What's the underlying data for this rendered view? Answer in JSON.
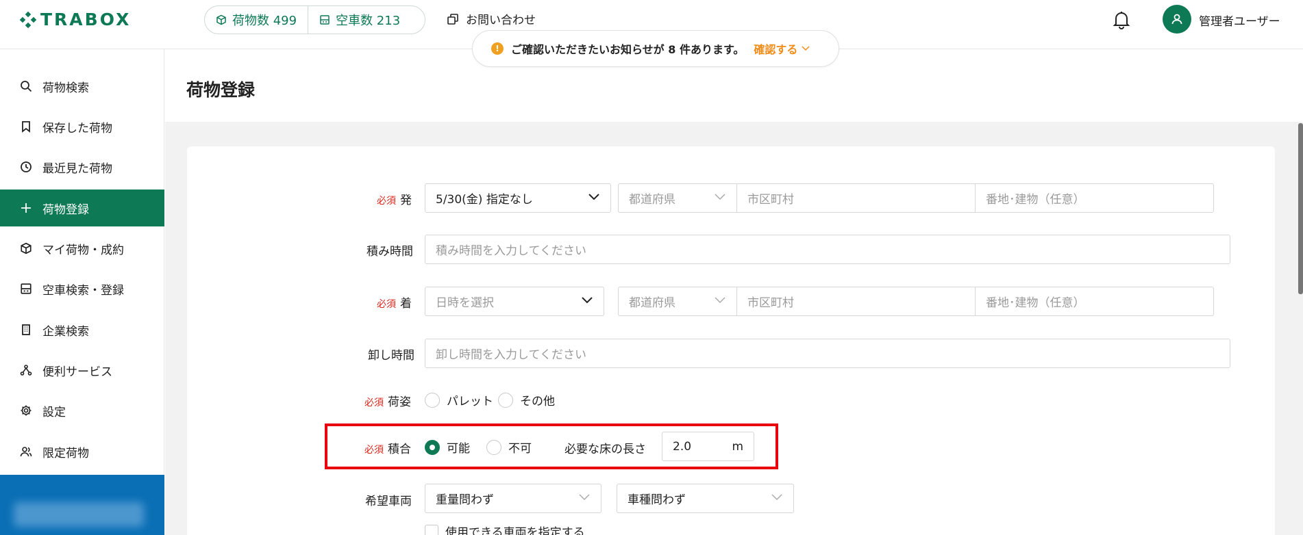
{
  "header": {
    "logo_text": "TRABOX",
    "cargo_count_label": "荷物数 499",
    "truck_count_label": "空車数 213",
    "contact_label": "お問い合わせ",
    "user_name": "管理者ユーザー"
  },
  "notice": {
    "info_mark": "!",
    "message": "ご確認いただきたいお知らせが 8 件あります。",
    "confirm_label": "確認する"
  },
  "sidebar": {
    "items": [
      {
        "label": "荷物検索",
        "icon": "search-icon"
      },
      {
        "label": "保存した荷物",
        "icon": "bookmark-icon"
      },
      {
        "label": "最近見た荷物",
        "icon": "history-icon"
      },
      {
        "label": "荷物登録",
        "icon": "plus-icon",
        "active": true
      },
      {
        "label": "マイ荷物・成約",
        "icon": "cube-icon"
      },
      {
        "label": "空車検索・登録",
        "icon": "truck-icon"
      },
      {
        "label": "企業検索",
        "icon": "building-icon"
      },
      {
        "label": "便利サービス",
        "icon": "network-icon"
      },
      {
        "label": "設定",
        "icon": "gear-icon"
      },
      {
        "label": "限定荷物",
        "icon": "people-icon"
      }
    ]
  },
  "page": {
    "title": "荷物登録"
  },
  "form": {
    "required_tag": "必須",
    "departure": {
      "label": "発",
      "date_value": "5/30(金) 指定なし",
      "prefecture_placeholder": "都道府県",
      "city_placeholder": "市区町村",
      "address_placeholder": "番地･建物（任意）"
    },
    "loading_time": {
      "label": "積み時間",
      "placeholder": "積み時間を入力してください"
    },
    "arrival": {
      "label": "着",
      "date_placeholder": "日時を選択",
      "prefecture_placeholder": "都道府県",
      "city_placeholder": "市区町村",
      "address_placeholder": "番地･建物（任意）"
    },
    "unloading_time": {
      "label": "卸し時間",
      "placeholder": "卸し時間を入力してください"
    },
    "packing": {
      "label": "荷姿",
      "option1": "パレット",
      "option2": "その他"
    },
    "consolidation": {
      "label": "積合",
      "option_yes": "可能",
      "option_no": "不可",
      "selected": "可能",
      "floor_length_label": "必要な床の長さ",
      "floor_length_value": "2.0",
      "floor_length_unit": "m"
    },
    "vehicle": {
      "label": "希望車両",
      "weight_value": "重量問わず",
      "type_value": "車種問わず",
      "specify_label": "使用できる車両を指定する"
    }
  },
  "colors": {
    "brand": "#0d7a55",
    "required": "#d9261c",
    "highlight": "#e8000f",
    "notice_accent": "#f08c1a"
  }
}
